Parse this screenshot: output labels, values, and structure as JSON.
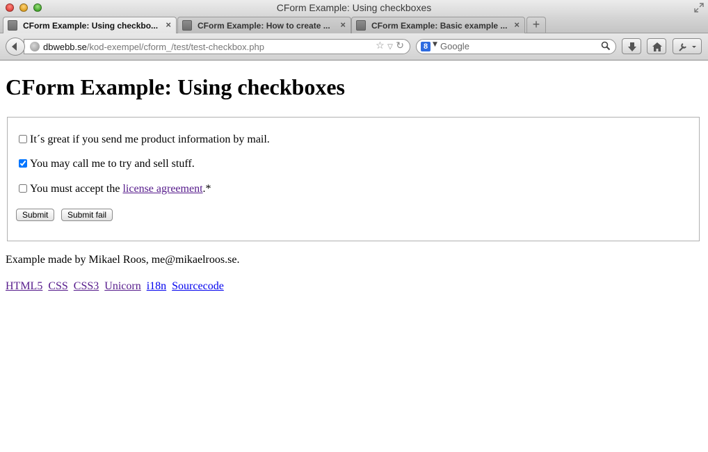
{
  "window": {
    "title": "CForm Example: Using checkboxes"
  },
  "tabs": [
    {
      "label": "CForm Example: Using checkbo...",
      "close": "×"
    },
    {
      "label": "CForm Example: How to create ...",
      "close": "×"
    },
    {
      "label": "CForm Example: Basic example ...",
      "close": "×"
    }
  ],
  "new_tab": "+",
  "address": {
    "host": "dbwebb.se",
    "path": "/kod-exempel/cform_/test/test-checkbox.php"
  },
  "search": {
    "engine_letter": "8",
    "placeholder": "Google"
  },
  "page": {
    "heading": "CForm Example: Using checkboxes",
    "checkboxes": [
      {
        "label": "It´s great if you send me product information by mail.",
        "checked": false
      },
      {
        "label": "You may call me to try and sell stuff.",
        "checked": true
      },
      {
        "label_before": "You must accept the ",
        "link": "license agreement",
        "label_after": ".*",
        "checked": false
      }
    ],
    "buttons": {
      "submit": "Submit",
      "submit_fail": "Submit fail"
    },
    "credit": "Example made by Mikael Roos, me@mikaelroos.se.",
    "footer_links": [
      "HTML5",
      "CSS",
      "CSS3",
      "Unicorn",
      "i18n",
      "Sourcecode"
    ]
  },
  "colors": {
    "link_visited": "#551a8b",
    "link_unvisited": "#0000ee"
  }
}
